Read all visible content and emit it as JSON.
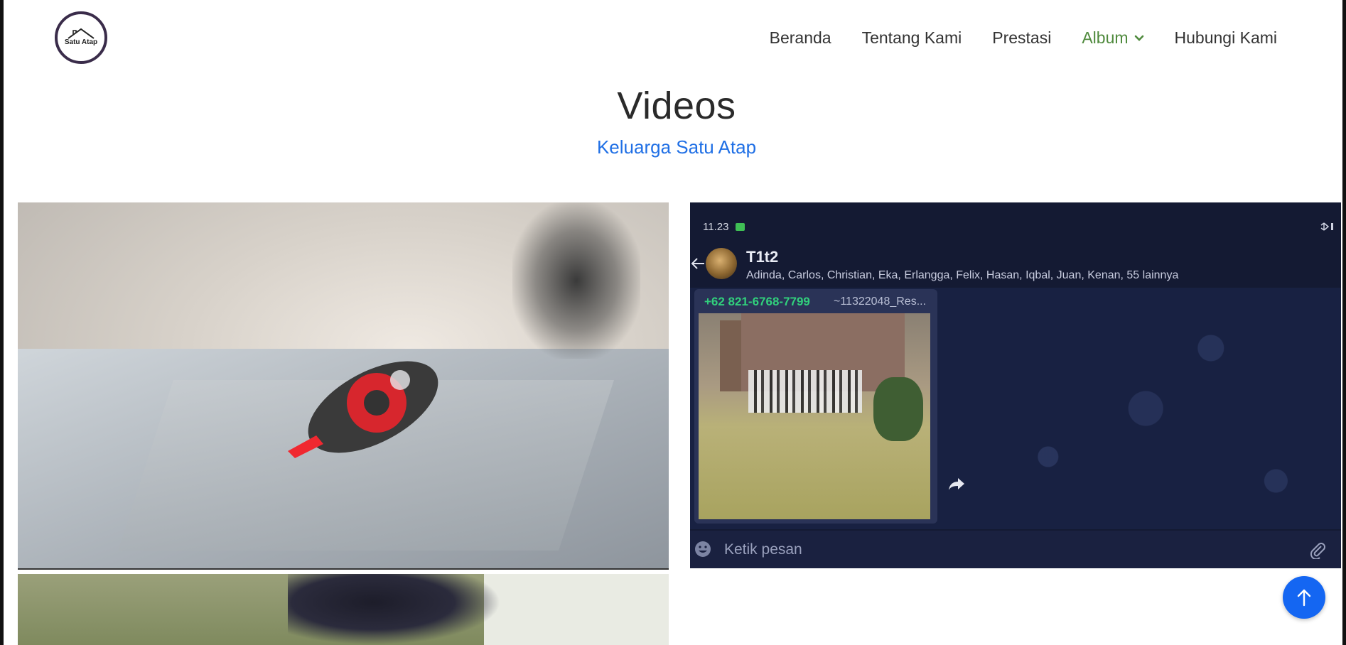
{
  "header": {
    "logo_text": "Satu Atap",
    "nav": [
      {
        "label": "Beranda"
      },
      {
        "label": "Tentang Kami"
      },
      {
        "label": "Prestasi"
      },
      {
        "label": "Album",
        "active": true,
        "icon": "chevron-down-icon"
      },
      {
        "label": "Hubungi Kami"
      }
    ]
  },
  "main": {
    "title": "Videos",
    "subtitle": "Keluarga Satu Atap"
  },
  "video2": {
    "status_time": "11.23",
    "group_name": "T1t2",
    "group_members": "Adinda, Carlos, Christian, Eka, Erlangga, Felix, Hasan, Iqbal, Juan, Kenan, 55 lainnya",
    "sender_phone": "+62 821-6768-7799",
    "sender_name": "~11322048_Res...",
    "input_placeholder": "Ketik pesan"
  },
  "colors": {
    "accent": "#1f6fe5",
    "nav_active": "#4f8a3d",
    "scroll_button": "#1466f2"
  }
}
